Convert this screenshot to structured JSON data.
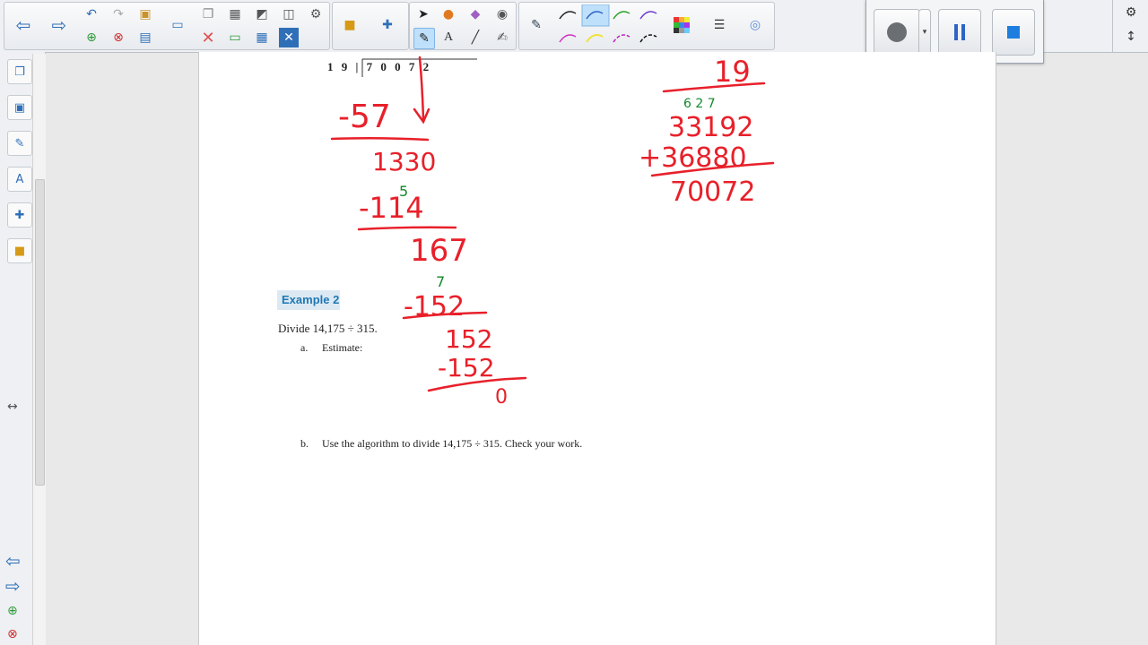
{
  "toolbar": {
    "buttons": [
      "back-icon",
      "forward-icon",
      "undo-icon",
      "redo-icon",
      "open-icon",
      "add-page-icon",
      "delete-page-icon",
      "save-icon",
      "screen-icon",
      "paste-icon",
      "screen-capture-icon",
      "shade-icon",
      "camera-icon",
      "pen-settings-icon",
      "delete-icon",
      "hide-icon",
      "table-icon",
      "close-icon",
      "gallery-icon",
      "addons-icon",
      "select-icon",
      "shapes-icon",
      "eraser-icon",
      "fill-icon",
      "text-pen-icon",
      "text-icon",
      "line-icon",
      "magic-pen-icon",
      "pen-icon",
      "color-icon",
      "line-style-icon",
      "transparency-icon"
    ]
  },
  "document": {
    "division_header": "1 9 | 7 0 0 7 2",
    "example_label": "Example 2",
    "problem": "Divide 14,175 ÷ 315.",
    "part_a_letter": "a.",
    "part_a_text": "Estimate:",
    "part_b_letter": "b.",
    "part_b_text": "Use the algorithm to divide 14,175 ÷ 315.  Check your work."
  },
  "handwriting": {
    "left": [
      "-57",
      "1330",
      "5",
      "-114",
      "167",
      "7",
      "-152",
      "152",
      "-152",
      "0"
    ],
    "right": [
      "19",
      "6 2 7",
      "33192",
      "+36880",
      "70072"
    ]
  },
  "colors": {
    "ink_red": "#e8202a",
    "ink_green": "#128a2a",
    "accent": "#2f6fb8",
    "example_bg": "#dce9f3",
    "example_text": "#1f78b4"
  }
}
